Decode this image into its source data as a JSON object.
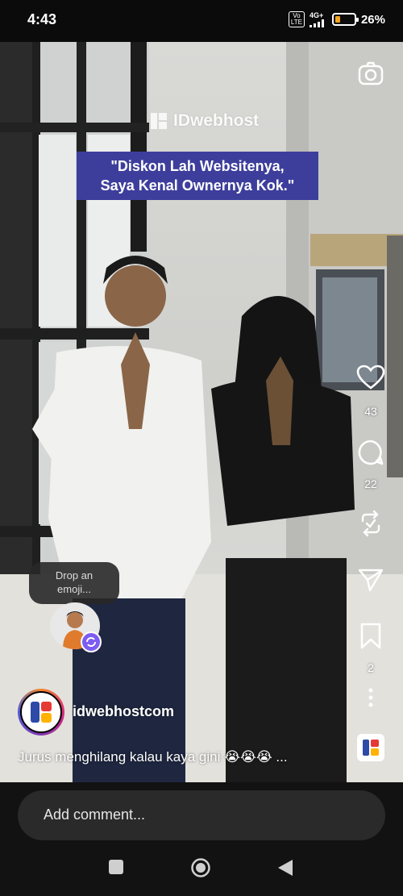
{
  "status_bar": {
    "time": "4:43",
    "volte_label": "Vo\nLTE",
    "network_label": "4G+",
    "battery_percent": 26,
    "battery_text": "26%",
    "battery_color": "#f5a623"
  },
  "video": {
    "brand_text": "IDwebhost",
    "caption_lines": [
      "\"Diskon Lah Websitenya,",
      "Saya Kenal Ownernya Kok.\""
    ],
    "caption_bg_color": "#3d3e9c"
  },
  "actions": {
    "camera_icon": "camera-icon",
    "like_icon": "heart-icon",
    "like_count": "43",
    "comment_icon": "comment-icon",
    "comment_count": "22",
    "remix_icon": "remix-icon",
    "share_icon": "send-icon",
    "save_icon": "bookmark-icon",
    "save_count": "2",
    "more_icon": "more-vertical-icon"
  },
  "emoji_prompt": {
    "text_line1": "Drop an",
    "text_line2": "emoji..."
  },
  "post": {
    "username": "idwebhostcom",
    "caption": "Jurus menghilang kalau kaya gini 😭😭😭 ..."
  },
  "comment": {
    "placeholder": "Add comment..."
  },
  "nav": {
    "recents_icon": "square-icon",
    "home_icon": "circle-icon",
    "back_icon": "triangle-back-icon"
  }
}
